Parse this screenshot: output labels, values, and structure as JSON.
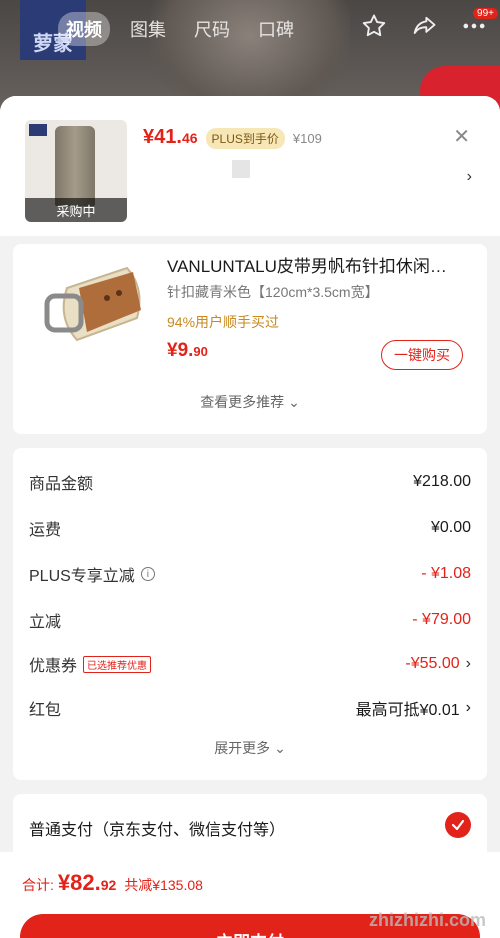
{
  "header": {
    "brand": "萝蒙",
    "tabs": [
      "视频",
      "图集",
      "尺码",
      "口碑"
    ],
    "active_tab": 0,
    "cart_badge": "99+"
  },
  "product": {
    "price_main": "¥41.",
    "price_decimal": "46",
    "plus_tag": "PLUS到手价",
    "original_price": "¥109",
    "thumb_status": "采购中"
  },
  "recommendation": {
    "title": "VANLUNTALU皮带男帆布针扣休闲…",
    "spec": "针扣藏青米色【120cm*3.5cm宽】",
    "rate": "94%用户顺手买过",
    "price_main": "¥9.",
    "price_decimal": "90",
    "buy_label": "一键购买",
    "more_label": "查看更多推荐"
  },
  "amounts": {
    "rows": [
      {
        "label": "商品金额",
        "value": "¥218.00"
      },
      {
        "label": "运费",
        "value": "¥0.00"
      },
      {
        "label": "PLUS专享立减",
        "value": "- ¥1.08"
      },
      {
        "label": "立减",
        "value": "- ¥79.00"
      },
      {
        "label": "优惠券",
        "tag": "已选推荐优惠",
        "value": "-¥55.00"
      },
      {
        "label": "红包",
        "value": "最高可抵¥0.01"
      }
    ],
    "expand_label": "展开更多"
  },
  "payment": {
    "label": "普通支付（京东支付、微信支付等）"
  },
  "footer": {
    "total_label": "合计:",
    "total_main": "¥82.",
    "total_decimal": "92",
    "saved": "共减¥135.08",
    "pay_button": "立即支付",
    "watermark": "zhizhizhi.com"
  },
  "colors": {
    "accent": "#e2231a",
    "plus_gold": "#f7e6b6"
  }
}
